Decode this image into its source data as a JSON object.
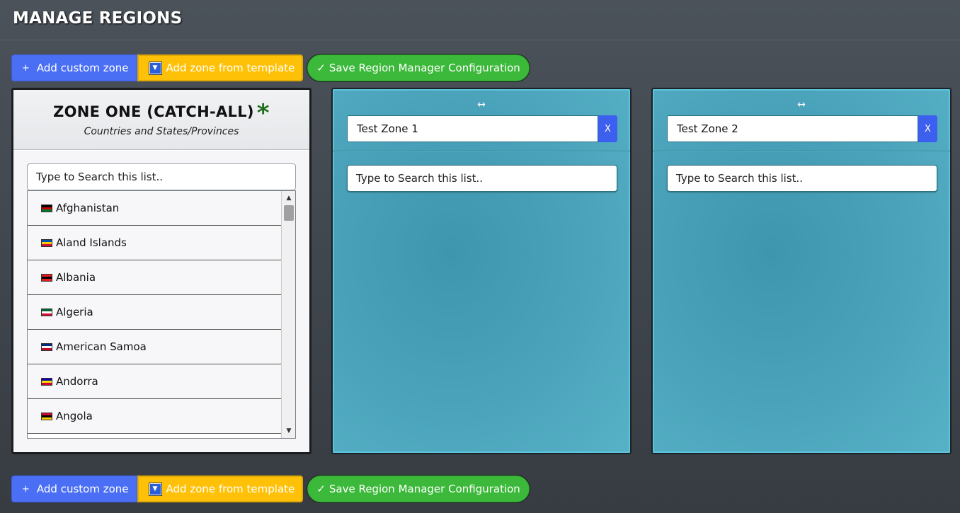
{
  "page": {
    "title": "MANAGE REGIONS"
  },
  "toolbar": {
    "add_custom_label": "Add custom zone",
    "add_template_label": "Add zone from template",
    "save_label": "Save Region Manager Configuration",
    "colors": {
      "add": "#4a6ff5",
      "template": "#ffc107",
      "save": "#3cb93a"
    }
  },
  "zone_one": {
    "title": "ZONE ONE (CATCH-ALL)",
    "marker": "*",
    "subtitle": "Countries and States/Provinces",
    "search_placeholder": "Type to Search this list..",
    "items": [
      {
        "label": "Afghanistan",
        "flag": [
          "#000000",
          "#cc0000",
          "#007a36"
        ]
      },
      {
        "label": "Aland Islands",
        "flag": [
          "#0053a5",
          "#ffce00",
          "#d21034"
        ]
      },
      {
        "label": "Albania",
        "flag": [
          "#e41e20",
          "#000000",
          "#e41e20"
        ]
      },
      {
        "label": "Algeria",
        "flag": [
          "#006233",
          "#ffffff",
          "#d21034"
        ]
      },
      {
        "label": "American Samoa",
        "flag": [
          "#002b7f",
          "#ffffff",
          "#bf0a30"
        ]
      },
      {
        "label": "Andorra",
        "flag": [
          "#10069f",
          "#fedf00",
          "#d50032"
        ]
      },
      {
        "label": "Angola",
        "flag": [
          "#cc092f",
          "#000000",
          "#ffcb00"
        ]
      }
    ]
  },
  "zones": [
    {
      "name": "Test Zone 1",
      "delete_label": "X",
      "search_placeholder": "Type to Search this list.."
    },
    {
      "name": "Test Zone 2",
      "delete_label": "X",
      "search_placeholder": "Type to Search this list.."
    }
  ],
  "icons": {
    "plus": "+",
    "dropdown": "▼",
    "check": "✓",
    "resize": "↔",
    "scroll_up": "▲",
    "scroll_down": "▼"
  }
}
